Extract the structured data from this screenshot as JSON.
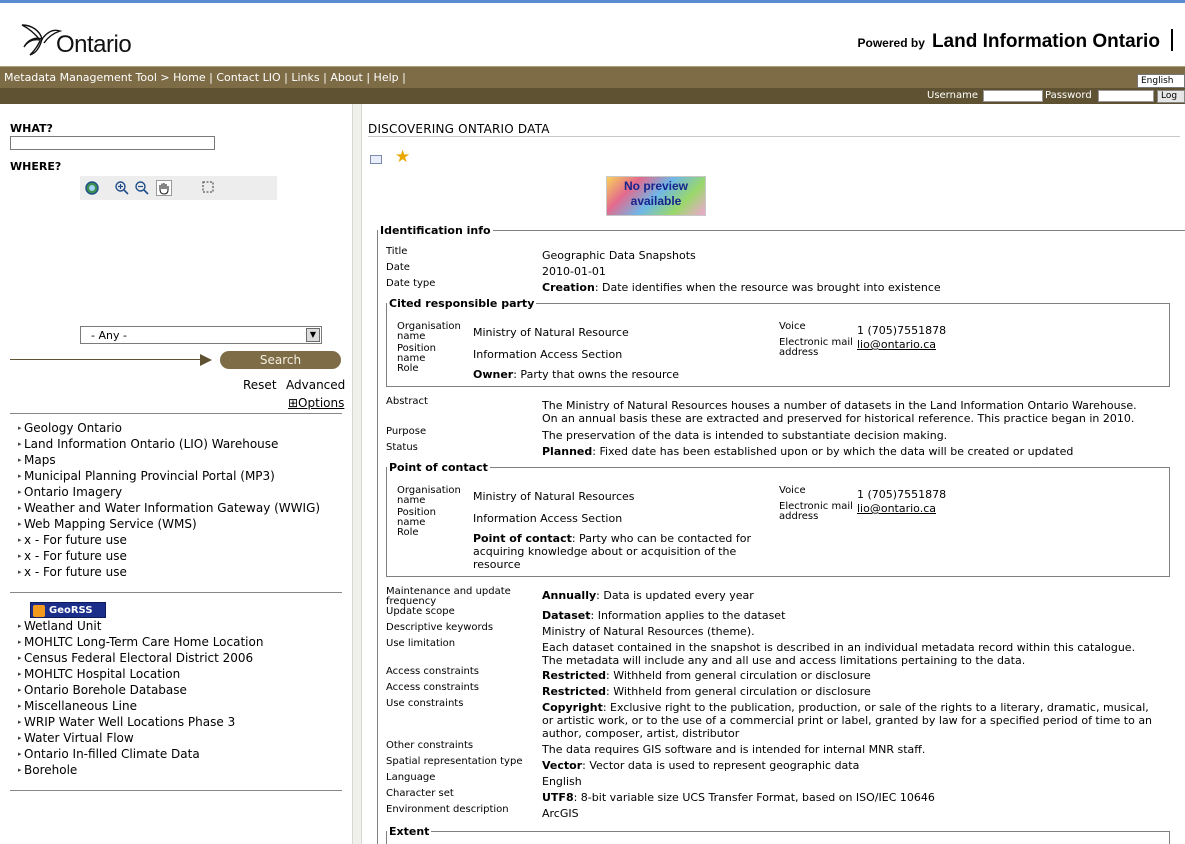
{
  "header": {
    "logo_text": "Ontario",
    "powered_prefix": "Powered by",
    "powered_brand": "Land Information Ontario"
  },
  "nav": {
    "breadcrumb": "Metadata Management Tool > Home",
    "links": [
      "Contact LIO",
      "Links",
      "About",
      "Help"
    ],
    "language": "English"
  },
  "login": {
    "username_label": "Username",
    "password_label": "Password",
    "button": "Log"
  },
  "search": {
    "what_label": "WHAT?",
    "where_label": "WHERE?",
    "region_selected": "- Any -",
    "search_button": "Search",
    "reset": "Reset",
    "advanced": "Advanced",
    "options": "⊞Options"
  },
  "map_tools": [
    "globe-icon",
    "zoom-in-icon",
    "zoom-out-icon",
    "pan-hand-icon",
    "select-box-icon"
  ],
  "categories": [
    "Geology Ontario",
    "Land Information Ontario (LIO) Warehouse",
    "Maps",
    "Municipal Planning Provincial Portal (MP3)",
    "Ontario Imagery",
    "Weather and Water Information Gateway (WWIG)",
    "Web Mapping Service (WMS)",
    "x - For future use",
    "x - For future use",
    "x - For future use"
  ],
  "georss": {
    "badge": "GeoRSS",
    "items": [
      "Wetland Unit",
      "MOHLTC Long-Term Care Home Location",
      "Census Federal Electoral District 2006",
      "MOHLTC Hospital Location",
      "Ontario Borehole Database",
      "Miscellaneous Line",
      "WRIP Water Well Locations Phase 3",
      "Water Virtual Flow",
      "Ontario In-filled Climate Data",
      "Borehole"
    ]
  },
  "content": {
    "title": "DISCOVERING ONTARIO DATA",
    "preview_line1": "No preview",
    "preview_line2": "available",
    "ident_legend": "Identification info",
    "title_label": "Title",
    "title_value": "Geographic Data Snapshots",
    "date_label": "Date",
    "date_value": "2010-01-01",
    "datetype_label": "Date type",
    "datetype_bold": "Creation",
    "datetype_rest": ": Date identifies when the resource was brought into existence",
    "cited": {
      "legend": "Cited responsible party",
      "org_label": "Organisation name",
      "org_value": "Ministry of Natural Resource",
      "pos_label": "Position name",
      "pos_value": "Information Access Section",
      "role_label": "Role",
      "role_bold": "Owner",
      "role_rest": ": Party that owns the resource",
      "voice_label": "Voice",
      "voice_value": "1 (705)7551878",
      "email_label": "Electronic mail address",
      "email_value": "lio@ontario.ca"
    },
    "abstract_label": "Abstract",
    "abstract_value": "The Ministry of Natural Resources houses a number of datasets in the Land Information Ontario Warehouse. On an annual basis these are extracted and preserved for historical reference. This practice began in 2010.",
    "purpose_label": "Purpose",
    "purpose_value": "The preservation of the data is intended to substantiate decision making.",
    "status_label": "Status",
    "status_bold": "Planned",
    "status_rest": ": Fixed date has been established upon or by which the data will be created or updated",
    "poc": {
      "legend": "Point of contact",
      "org_label": "Organisation name",
      "org_value": "Ministry of Natural Resources",
      "pos_label": "Position name",
      "pos_value": "Information Access Section",
      "role_label": "Role",
      "role_bold": "Point of contact",
      "role_rest": ": Party who can be contacted for acquiring knowledge about or acquisition of the resource",
      "voice_label": "Voice",
      "voice_value": "1 (705)7551878",
      "email_label": "Electronic mail address",
      "email_value": "lio@ontario.ca"
    },
    "maint_label": "Maintenance and update frequency",
    "maint_bold": "Annually",
    "maint_rest": ": Data is updated every year",
    "scope_label": "Update scope",
    "scope_bold": "Dataset",
    "scope_rest": ": Information applies to the dataset",
    "keywords_label": "Descriptive keywords",
    "keywords_value": "Ministry of Natural Resources (theme).",
    "uselimit_label": "Use limitation",
    "uselimit_value": "Each dataset contained in the snapshot is described in an individual metadata record within this catalogue. The metadata will include any and all use and access limitations pertaining to the data.",
    "access1_label": "Access constraints",
    "access1_bold": "Restricted",
    "access1_rest": ": Withheld from general circulation or disclosure",
    "access2_label": "Access constraints",
    "access2_bold": "Restricted",
    "access2_rest": ": Withheld from general circulation or disclosure",
    "usecons_label": "Use constraints",
    "usecons_bold": "Copyright",
    "usecons_rest": ": Exclusive right to the publication, production, or sale of the rights to a literary, dramatic, musical, or artistic work, or to the use of a commercial print or label, granted by law for a specified period of time to an author, composer, artist, distributor",
    "other_label": "Other constraints",
    "other_value": "The data requires GIS software and is intended for internal MNR staff.",
    "spatial_label": "Spatial representation type",
    "spatial_bold": "Vector",
    "spatial_rest": ": Vector data is used to represent geographic data",
    "language_label": "Language",
    "language_value": "English",
    "charset_label": "Character set",
    "charset_bold": "UTF8",
    "charset_rest": ": 8-bit variable size UCS Transfer Format, based on ISO/IEC 10646",
    "env_label": "Environment description",
    "env_value": "ArcGIS",
    "extent_legend": "Extent"
  },
  "colors": {
    "nav_bar": "#7e6c46",
    "login_bar": "#5e5232",
    "header_accent": "#5b8bd0"
  }
}
